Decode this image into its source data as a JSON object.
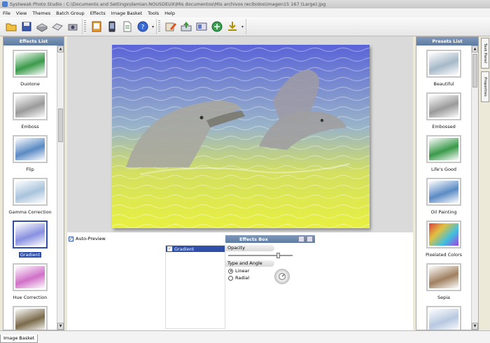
{
  "window": {
    "title": "Systweak Photo Studio : C:\\Documents and Settings\\damian.NOUSDEUX\\Mis documentos\\Mis archivos recibidos\\imagen15 167 (Large).jpg"
  },
  "menu": [
    "File",
    "View",
    "Themes",
    "Batch Group",
    "Effects",
    "Image Basket",
    "Tools",
    "Help"
  ],
  "effects_list": {
    "title": "Effects List",
    "items": [
      {
        "label": "Duotone",
        "selected": false,
        "tint": "#3a9a4a"
      },
      {
        "label": "Emboss",
        "selected": false,
        "tint": "#9a9a9a"
      },
      {
        "label": "Flip",
        "selected": false,
        "tint": "#5a8ac4"
      },
      {
        "label": "Gamma Correction",
        "selected": false,
        "tint": "#a9c4dc"
      },
      {
        "label": "Gradient",
        "selected": true,
        "tint": "#8890e0"
      },
      {
        "label": "Hue Correction",
        "selected": false,
        "tint": "#d070c8"
      },
      {
        "label": "",
        "selected": false,
        "tint": "#7a6a4a"
      }
    ]
  },
  "presets_list": {
    "title": "Presets List",
    "items": [
      {
        "label": "Beautiful",
        "tint": "#a6b8c8"
      },
      {
        "label": "Embossed",
        "tint": "#9a9a9a"
      },
      {
        "label": "Life's Good",
        "tint": "#3a9a4a"
      },
      {
        "label": "Oil Painting",
        "tint": "#5a8ac4"
      },
      {
        "label": "Pixelated Colors",
        "tint": "#c080d0"
      },
      {
        "label": "Sepia",
        "tint": "#a08060"
      },
      {
        "label": "",
        "tint": "#b8c8e0"
      }
    ]
  },
  "lower": {
    "auto_preview": "Auto-Preview",
    "auto_preview_checked": true,
    "applied_effects": [
      "Gradient"
    ],
    "effects_box": {
      "title": "Effects Box",
      "opacity_label": "Opacity",
      "opacity_value": 0.82,
      "type_label": "Type and Angle",
      "options": [
        {
          "label": "Linear",
          "checked": true
        },
        {
          "label": "Radial",
          "checked": false
        }
      ]
    }
  },
  "side_tabs": [
    "Task Panel",
    "Properties"
  ],
  "status": {
    "tab": "Image Basket"
  },
  "colors": {
    "panel_header": "#6a86ad",
    "selection": "#2f4fa8",
    "gradient_top": "#5a64d8",
    "gradient_bottom": "#e8f040"
  }
}
